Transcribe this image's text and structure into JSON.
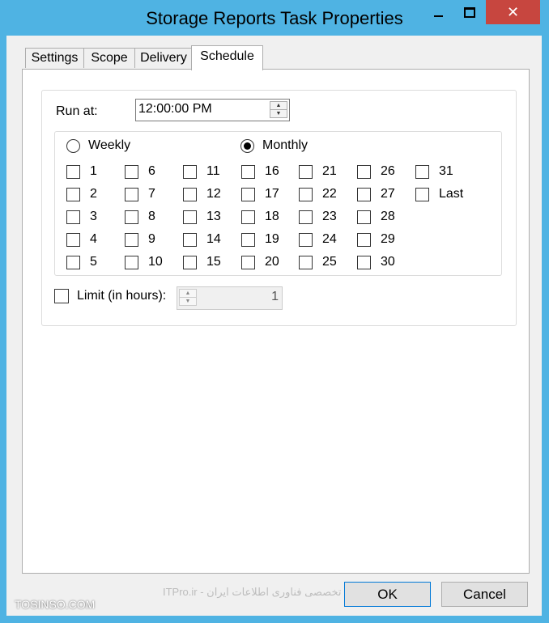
{
  "window": {
    "title": "Storage Reports Task Properties",
    "close_glyph": "✕",
    "accent_color": "#4fb3e3",
    "close_color": "#c7463f"
  },
  "tabs": [
    "Settings",
    "Scope",
    "Delivery",
    "Schedule"
  ],
  "schedule": {
    "run_at_label": "Run at:",
    "run_at_value": "12:00:00 PM",
    "weekly_label": "Weekly",
    "monthly_label": "Monthly",
    "selected_mode": "Monthly",
    "days": [
      "1",
      "2",
      "3",
      "4",
      "5",
      "6",
      "7",
      "8",
      "9",
      "10",
      "11",
      "12",
      "13",
      "14",
      "15",
      "16",
      "17",
      "18",
      "19",
      "20",
      "21",
      "22",
      "23",
      "24",
      "25",
      "26",
      "27",
      "28",
      "29",
      "30",
      "31",
      "Last"
    ],
    "limit_label": "Limit (in hours):",
    "limit_value": "1"
  },
  "buttons": {
    "ok": "OK",
    "cancel": "Cancel"
  },
  "watermark": {
    "center_text": "ITPro.ir - انجمن تخصصی فناوری اطلاعات ایران",
    "corner_text": "TOSINSO.COM"
  },
  "icons": {
    "minimize": "minimize-icon",
    "maximize": "maximize-icon",
    "close": "close-icon",
    "spin_up": "chevron-up-icon",
    "spin_down": "chevron-down-icon"
  }
}
